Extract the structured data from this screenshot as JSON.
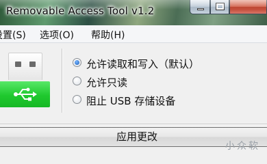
{
  "window": {
    "title": "Removable Access Tool v1.2"
  },
  "menu": {
    "settings": "设置(S)",
    "options": "选项(O)",
    "help": "帮助(H)"
  },
  "options": [
    {
      "label": "允许读取和写入（默认）",
      "selected": true
    },
    {
      "label": "允许只读",
      "selected": false
    },
    {
      "label": "阻止 USB 存储设备",
      "selected": false
    }
  ],
  "apply_button": {
    "label": "应用更改"
  },
  "watermark": "小众软",
  "colors": {
    "usb_green": "#1fc92e",
    "radio_selected": "#1c5fb8",
    "close_button": "#cf5b44"
  },
  "icons": {
    "usb_plug": "usb-plug-icon",
    "usb_symbol": "usb-symbol-icon"
  }
}
